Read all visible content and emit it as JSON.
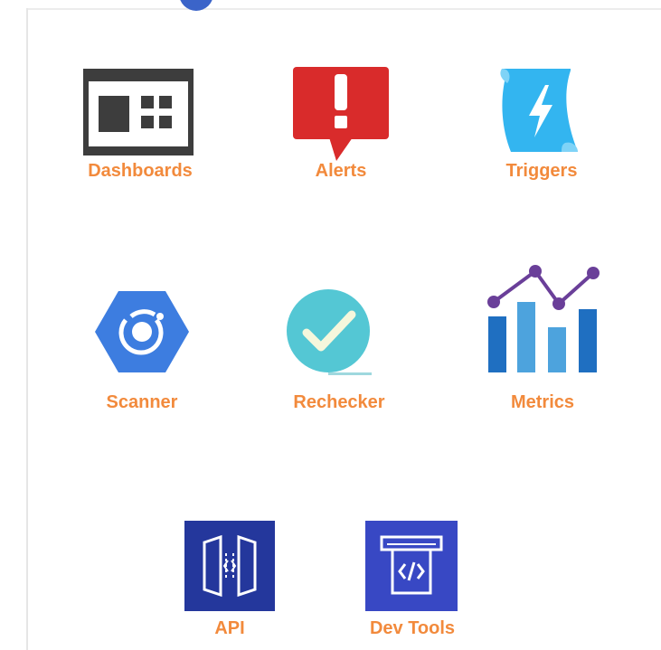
{
  "tiles": {
    "dashboards": {
      "label": "Dashboards",
      "icon": "dashboard-window-icon"
    },
    "alerts": {
      "label": "Alerts",
      "icon": "alert-bubble-icon"
    },
    "triggers": {
      "label": "Triggers",
      "icon": "lightning-scroll-icon"
    },
    "scanner": {
      "label": "Scanner",
      "icon": "scanner-hexagon-icon"
    },
    "rechecker": {
      "label": "Rechecker",
      "icon": "checkmark-circle-icon"
    },
    "metrics": {
      "label": "Metrics",
      "icon": "bar-line-chart-icon"
    },
    "api": {
      "label": "API",
      "icon": "api-gateway-icon"
    },
    "devtools": {
      "label": "Dev Tools",
      "icon": "code-terminal-icon"
    }
  },
  "colors": {
    "label": "#f28a3c",
    "dashboard_dark": "#3d3d3d",
    "alert_red": "#d92b2b",
    "trigger_blue": "#33b5f0",
    "scanner_blue": "#3d7de0",
    "rechecker_teal": "#54c7d4",
    "metrics_bar_dark": "#1f6fc1",
    "metrics_bar_light": "#4da3dd",
    "metrics_line": "#6a3f99",
    "api_navy": "#24379c",
    "devtools_blue": "#3848c4"
  }
}
